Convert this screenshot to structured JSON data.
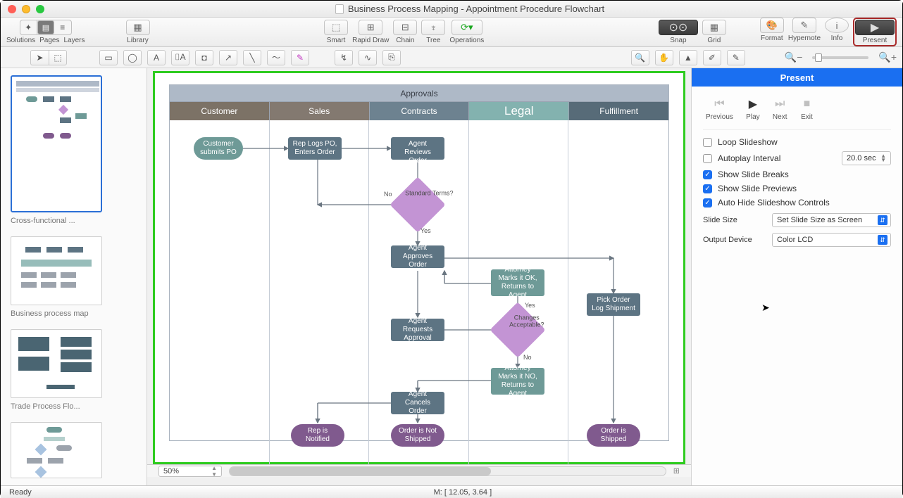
{
  "title": "Business Process Mapping - Appointment Procedure Flowchart",
  "toolbar": {
    "groups": {
      "solutions": "Solutions",
      "pages": "Pages",
      "layers": "Layers",
      "library": "Library",
      "smart": "Smart",
      "rapid": "Rapid Draw",
      "chain": "Chain",
      "tree": "Tree",
      "ops": "Operations",
      "snap": "Snap",
      "grid": "Grid",
      "format": "Format",
      "hypernote": "Hypernote",
      "info": "Info",
      "present": "Present"
    }
  },
  "pages": [
    {
      "label": "Cross-functional ..."
    },
    {
      "label": "Business process map"
    },
    {
      "label": "Trade Process Flo..."
    }
  ],
  "chart_data": {
    "type": "flowchart",
    "title": "Approvals",
    "lanes": [
      "Customer",
      "Sales",
      "Contracts",
      "Legal",
      "Fulfillment"
    ],
    "nodes": {
      "cust_po": "Customer submits PO",
      "rep_logs": "Rep Logs PO, Enters Order",
      "agent_reviews": "Contracts Agent Reviews Order",
      "std_terms": "Standard Terms?",
      "agent_approves": "Agent Approves Order",
      "atty_ok": "Attorney Marks it OK, Returns to Agent",
      "changes": "Changes Acceptable?",
      "agent_req": "Agent Requests Approval",
      "atty_no": "Attorney Marks it NO, Returns to Agent",
      "agent_cancels": "Agent Cancels Order",
      "rep_notified": "Rep is Notified",
      "not_shipped": "Order is Not Shipped",
      "pick_order": "Pick Order Log Shipment",
      "shipped": "Order is Shipped"
    },
    "edge_labels": {
      "no1": "No",
      "yes1": "Yes",
      "yes2": "Yes",
      "no2": "No"
    }
  },
  "present_panel": {
    "title": "Present",
    "controls": {
      "previous": "Previous",
      "play": "Play",
      "next": "Next",
      "exit": "Exit"
    },
    "options": {
      "loop": "Loop Slideshow",
      "autoplay": "Autoplay Interval",
      "autoplay_val": "20.0 sec",
      "breaks": "Show Slide Breaks",
      "previews": "Show Slide Previews",
      "autohide": "Auto Hide Slideshow Controls",
      "slidesize_label": "Slide Size",
      "slidesize_val": "Set Slide Size as Screen",
      "output_label": "Output Device",
      "output_val": "Color LCD"
    }
  },
  "zoom": "50%",
  "status": {
    "ready": "Ready",
    "coords": "M: [ 12.05, 3.64 ]"
  }
}
